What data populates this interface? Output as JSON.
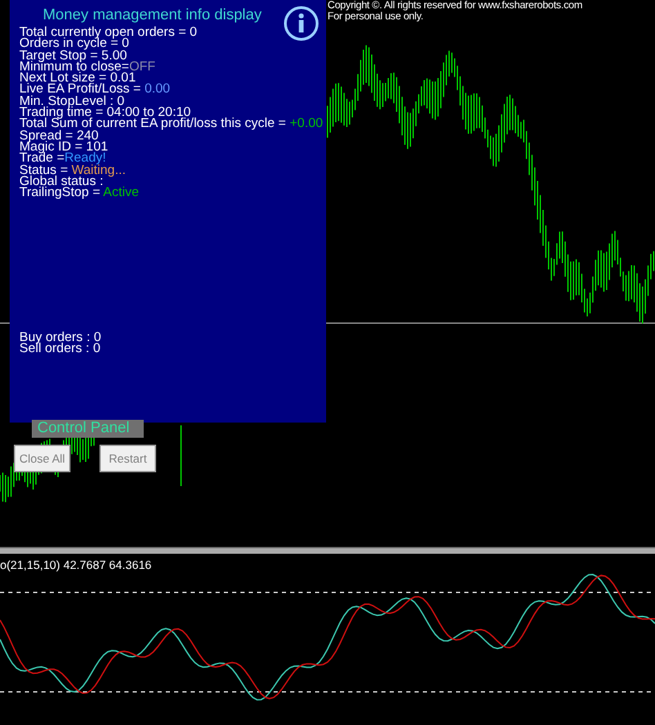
{
  "copyright": [
    "Copyright ©. All rights reserved for www.fxsharerobots.com",
    "For personal use only."
  ],
  "info_panel": {
    "title": "Money management info display",
    "lines": [
      {
        "label": "Total currently open orders = 0"
      },
      {
        "label": "Orders in cycle = 0"
      },
      {
        "label": "Target Stop = 5.00"
      },
      {
        "label": "Minimum to close=",
        "value": "OFF",
        "color": "#8a8aa8"
      },
      {
        "label": "Next Lot size = 0.01"
      },
      {
        "label": "Live EA Profit/Loss = ",
        "value": "0.00",
        "color": "#6699ff"
      },
      {
        "label": "Min. StopLevel : 0"
      },
      {
        "label": "Trading time = 04:00 to 20:10"
      },
      {
        "label": "Total Sum of current EA profit/loss this cycle = ",
        "value": "+0.00",
        "color": "#00c000"
      },
      {
        "label": "Spread = 240"
      },
      {
        "label": "Magic ID = 101"
      },
      {
        "label": "Trade =",
        "value": "Ready!",
        "color": "#3399ff"
      },
      {
        "label": "Status = ",
        "value": "Waiting...",
        "color": "#e09a50"
      },
      {
        "label": "Global status :"
      },
      {
        "label": "TrailingStop = ",
        "value": "Active",
        "color": "#00c000"
      }
    ],
    "footer": [
      "Buy orders : 0",
      "Sell orders : 0"
    ]
  },
  "control_panel": {
    "title": "Control Panel",
    "buttons": [
      "Close All",
      "Restart"
    ]
  },
  "indicator": {
    "label": "o(21,15,10) 42.7687 64.3616"
  }
}
